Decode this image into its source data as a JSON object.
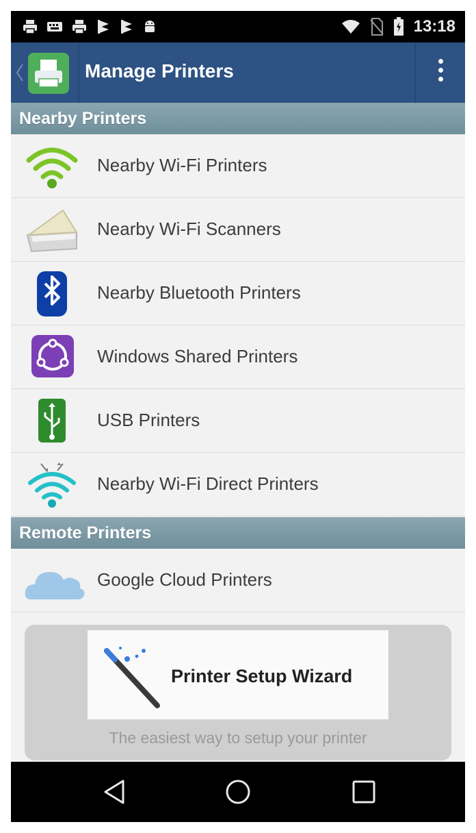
{
  "status_bar": {
    "time": "13:18",
    "left_icons": [
      "printer-icon",
      "keyboard-icon",
      "printer-icon",
      "flag-icon",
      "flag-icon",
      "android-icon"
    ],
    "right_icons": [
      "wifi-icon",
      "no-sim-icon",
      "battery-icon"
    ]
  },
  "app_bar": {
    "title": "Manage Printers",
    "app_icon": "printer-app-icon",
    "menu_icon": "overflow-menu-icon",
    "background": "#2d5283"
  },
  "sections": [
    {
      "header": "Nearby Printers",
      "items": [
        {
          "label": "Nearby Wi-Fi Printers",
          "icon": "wifi-green-icon"
        },
        {
          "label": "Nearby Wi-Fi Scanners",
          "icon": "scanner-icon"
        },
        {
          "label": "Nearby Bluetooth Printers",
          "icon": "bluetooth-icon"
        },
        {
          "label": "Windows Shared Printers",
          "icon": "network-share-icon"
        },
        {
          "label": "USB Printers",
          "icon": "usb-icon"
        },
        {
          "label": "Nearby Wi-Fi Direct Printers",
          "icon": "wifi-direct-icon"
        }
      ]
    },
    {
      "header": "Remote Printers",
      "items": [
        {
          "label": "Google Cloud Printers",
          "icon": "cloud-icon"
        }
      ]
    }
  ],
  "wizard": {
    "button_label": "Printer Setup Wizard",
    "caption": "The easiest way to setup your printer",
    "icon": "magic-wand-icon"
  },
  "nav_bar": {
    "icons": [
      "back-nav-icon",
      "home-nav-icon",
      "recents-nav-icon"
    ]
  },
  "colors": {
    "app_bar": "#2d5283",
    "section_header": "#7f9ba6",
    "list_background": "#f2f2f2"
  }
}
